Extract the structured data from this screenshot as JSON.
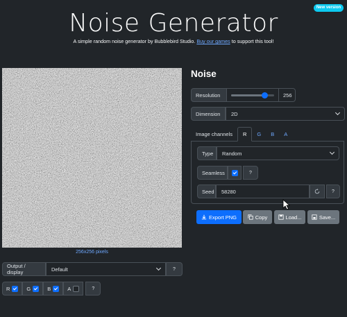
{
  "badge": "New version",
  "header": {
    "title": "Noise Generator",
    "subtitle_before": "A simple random noise generator by Bubblebird Studio.",
    "subtitle_link": "Buy our games",
    "subtitle_after": "to support this tool!"
  },
  "preview": {
    "size_label": "256x256 pixels"
  },
  "output": {
    "label": "Output / display",
    "selected": "Default",
    "help": "?",
    "channels": [
      {
        "label": "R",
        "checked": true
      },
      {
        "label": "G",
        "checked": true
      },
      {
        "label": "B",
        "checked": true
      },
      {
        "label": "A",
        "checked": false
      }
    ],
    "channels_help": "?"
  },
  "panel": {
    "heading": "Noise",
    "resolution": {
      "label": "Resolution",
      "value": "256",
      "slider_fraction": 0.78
    },
    "dimension": {
      "label": "Dimension",
      "selected": "2D"
    },
    "tabs": [
      "Image channels",
      "R",
      "G",
      "B",
      "A"
    ],
    "active_tab": "R",
    "type": {
      "label": "Type",
      "selected": "Random"
    },
    "seamless": {
      "label": "Seamless",
      "checked": true,
      "help": "?"
    },
    "seed": {
      "label": "Seed",
      "value": "58280",
      "help": "?"
    }
  },
  "actions": {
    "export": "Export PNG",
    "copy": "Copy",
    "load": "Load...",
    "save": "Save..."
  },
  "colors": {
    "accent": "#0d6efd",
    "badge": "#0dcaf0",
    "link": "#6ea8fe",
    "background": "#212529"
  },
  "icons": [
    "download-icon",
    "copy-icon",
    "load-icon",
    "save-icon",
    "refresh-icon",
    "chevron-down-icon",
    "mouse-cursor-icon"
  ]
}
